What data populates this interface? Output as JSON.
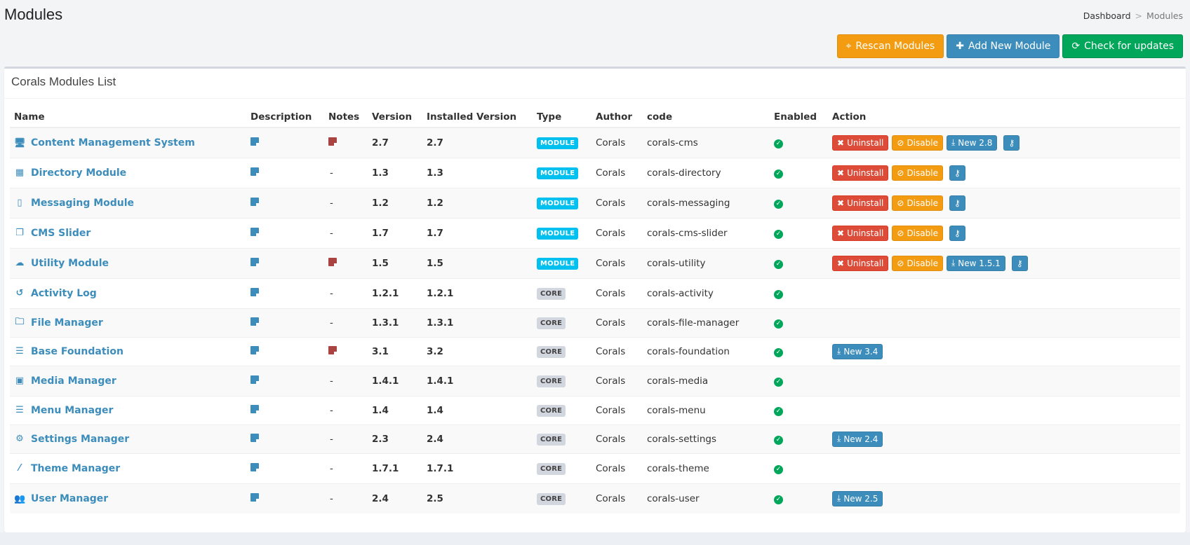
{
  "header": {
    "title": "Modules",
    "breadcrumb": [
      "Dashboard",
      "Modules"
    ]
  },
  "actions": {
    "rescan": "Rescan Modules",
    "add": "Add New Module",
    "check": "Check for updates"
  },
  "box": {
    "title": "Corals Modules List"
  },
  "columns": [
    "Name",
    "Description",
    "Notes",
    "Version",
    "Installed Version",
    "Type",
    "Author",
    "code",
    "Enabled",
    "Action"
  ],
  "buttons": {
    "uninstall": "Uninstall",
    "disable": "Disable"
  },
  "rows": [
    {
      "icon": "desktop-icon",
      "glyph": "🖥",
      "name": "Content Management System",
      "notes": "icon",
      "version": "2.7",
      "installed": "2.7",
      "type": "MODULE",
      "author": "Corals",
      "code": "corals-cms",
      "manage": true,
      "update": "New 2.8"
    },
    {
      "icon": "grid-icon",
      "glyph": "▦",
      "name": "Directory Module",
      "notes": "-",
      "version": "1.3",
      "installed": "1.3",
      "type": "MODULE",
      "author": "Corals",
      "code": "corals-directory",
      "manage": true,
      "update": ""
    },
    {
      "icon": "mobile-icon",
      "glyph": "▯",
      "name": "Messaging Module",
      "notes": "-",
      "version": "1.2",
      "installed": "1.2",
      "type": "MODULE",
      "author": "Corals",
      "code": "corals-messaging",
      "manage": true,
      "update": ""
    },
    {
      "icon": "clone-icon",
      "glyph": "❐",
      "name": "CMS Slider",
      "notes": "-",
      "version": "1.7",
      "installed": "1.7",
      "type": "MODULE",
      "author": "Corals",
      "code": "corals-cms-slider",
      "manage": true,
      "update": ""
    },
    {
      "icon": "cloud-icon",
      "glyph": "☁",
      "name": "Utility Module",
      "notes": "icon",
      "version": "1.5",
      "installed": "1.5",
      "type": "MODULE",
      "author": "Corals",
      "code": "corals-utility",
      "manage": true,
      "update": "New 1.5.1"
    },
    {
      "icon": "history-icon",
      "glyph": "↺",
      "name": "Activity Log",
      "notes": "-",
      "version": "1.2.1",
      "installed": "1.2.1",
      "type": "CORE",
      "author": "Corals",
      "code": "corals-activity",
      "manage": false,
      "update": ""
    },
    {
      "icon": "folder-icon",
      "glyph": "🗀",
      "name": "File Manager",
      "notes": "-",
      "version": "1.3.1",
      "installed": "1.3.1",
      "type": "CORE",
      "author": "Corals",
      "code": "corals-file-manager",
      "manage": false,
      "update": ""
    },
    {
      "icon": "bars-icon",
      "glyph": "☰",
      "name": "Base Foundation",
      "notes": "icon",
      "version": "3.1",
      "installed": "3.2",
      "type": "CORE",
      "author": "Corals",
      "code": "corals-foundation",
      "manage": false,
      "update": "New 3.4"
    },
    {
      "icon": "image-icon",
      "glyph": "▣",
      "name": "Media Manager",
      "notes": "-",
      "version": "1.4.1",
      "installed": "1.4.1",
      "type": "CORE",
      "author": "Corals",
      "code": "corals-media",
      "manage": false,
      "update": ""
    },
    {
      "icon": "bars-icon",
      "glyph": "☰",
      "name": "Menu Manager",
      "notes": "-",
      "version": "1.4",
      "installed": "1.4",
      "type": "CORE",
      "author": "Corals",
      "code": "corals-menu",
      "manage": false,
      "update": ""
    },
    {
      "icon": "cogs-icon",
      "glyph": "⚙",
      "name": "Settings Manager",
      "notes": "-",
      "version": "2.3",
      "installed": "2.4",
      "type": "CORE",
      "author": "Corals",
      "code": "corals-settings",
      "manage": false,
      "update": "New 2.4"
    },
    {
      "icon": "magic-icon",
      "glyph": "⁄",
      "name": "Theme Manager",
      "notes": "-",
      "version": "1.7.1",
      "installed": "1.7.1",
      "type": "CORE",
      "author": "Corals",
      "code": "corals-theme",
      "manage": false,
      "update": ""
    },
    {
      "icon": "users-icon",
      "glyph": "👥",
      "name": "User Manager",
      "notes": "-",
      "version": "2.4",
      "installed": "2.5",
      "type": "CORE",
      "author": "Corals",
      "code": "corals-user",
      "manage": false,
      "update": "New 2.5"
    }
  ]
}
